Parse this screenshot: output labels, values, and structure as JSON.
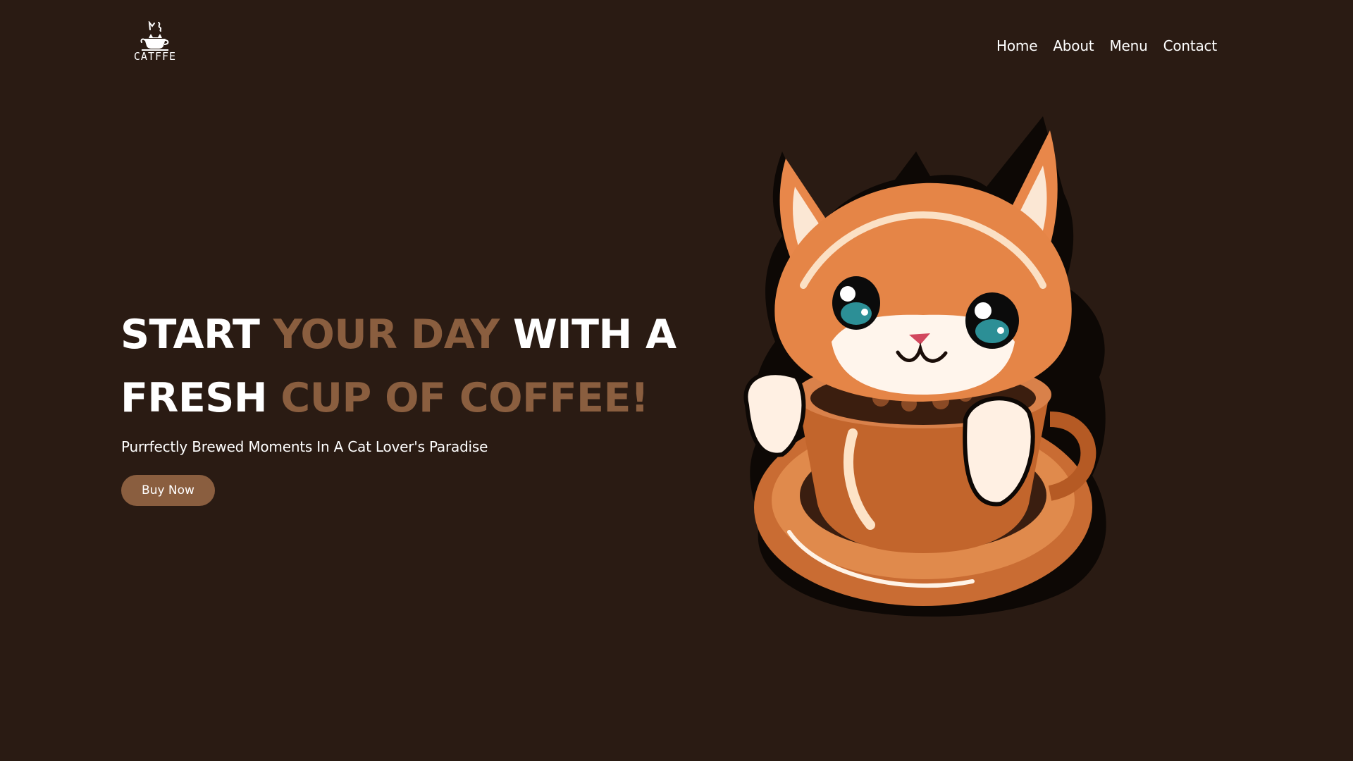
{
  "header": {
    "logo_text": "CATFFE",
    "nav": [
      "Home",
      "About",
      "Menu",
      "Contact"
    ]
  },
  "hero": {
    "title_line1": {
      "part1": "START ",
      "part2": "YOUR DAY",
      "part3": " WITH A"
    },
    "title_line2": {
      "part1": "FRESH ",
      "part2": "CUP OF COFFEE!"
    },
    "subtitle": "Purrfectly Brewed Moments In A Cat Lover's Paradise",
    "button": "Buy Now"
  },
  "colors": {
    "background": "#2a1b13",
    "accent": "#8a5e3f",
    "text": "#ffffff"
  },
  "icons": {
    "logo": "cat-coffee-cup-icon",
    "illustration": "cat-in-coffee-cup-illustration"
  }
}
